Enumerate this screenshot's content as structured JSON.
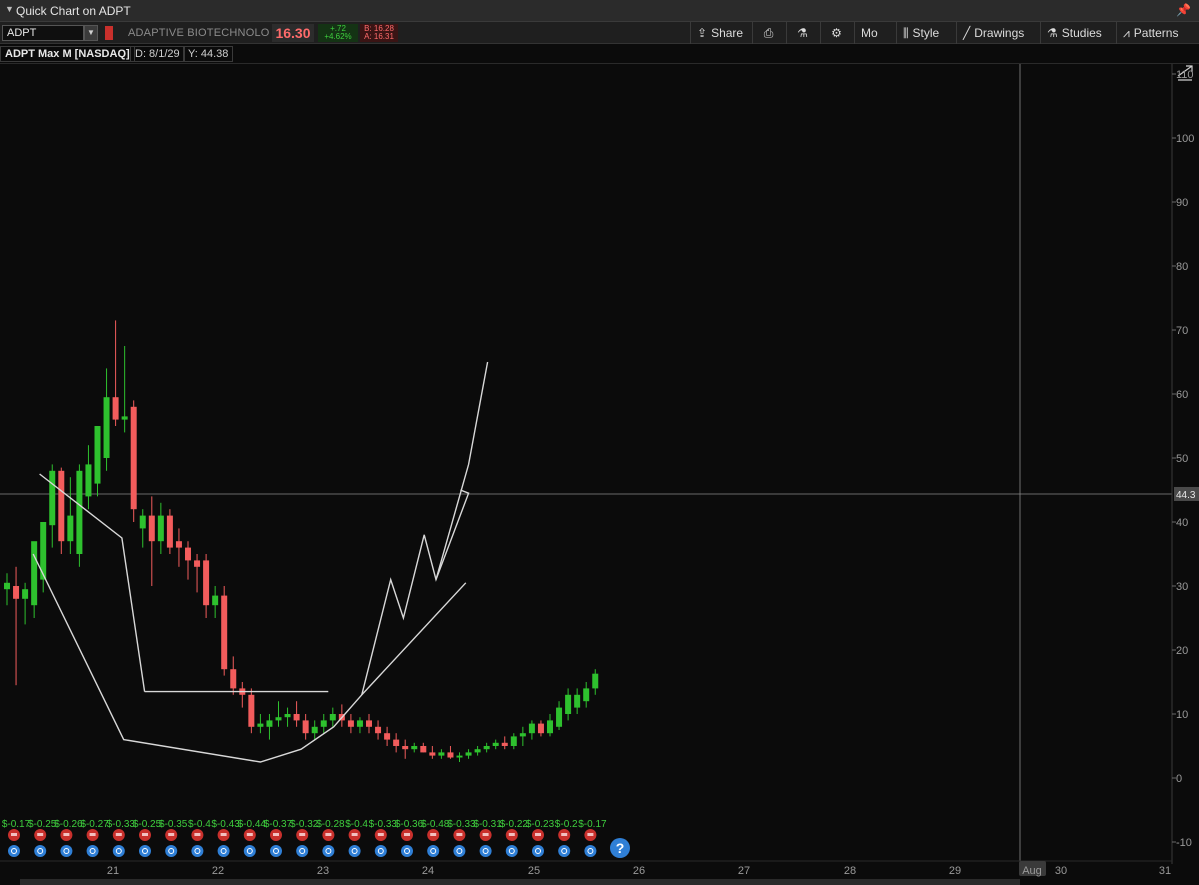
{
  "window": {
    "title": "Quick Chart on ADPT"
  },
  "toolbar": {
    "symbol": "ADPT",
    "company": "ADAPTIVE BIOTECHNOLO",
    "last_price": "16.30",
    "change": "+.72",
    "change_pct": "+4.62%",
    "bid": "B: 16.28",
    "ask": "A: 16.31",
    "buttons": {
      "share": "Share",
      "mo": "Mo",
      "style": "Style",
      "drawings": "Drawings",
      "studies": "Studies",
      "patterns": "Patterns"
    }
  },
  "infobar": {
    "chart_title": "ADPT Max M [NASDAQ]",
    "date_readout": "D: 8/1/29",
    "y_readout": "Y: 44.38"
  },
  "price_axis": {
    "ticks": [
      110,
      100,
      90,
      80,
      70,
      60,
      50,
      40,
      30,
      20,
      10,
      0,
      -10
    ],
    "crosshair_label": "44.3"
  },
  "time_axis": {
    "labels": [
      "21",
      "22",
      "23",
      "24",
      "25",
      "26",
      "27",
      "28",
      "29",
      "Aug",
      "30",
      "31"
    ]
  },
  "earnings": [
    "$-0.17",
    "$-0.25",
    "$-0.26",
    "$-0.27",
    "$-0.33",
    "$-0.25",
    "$-0.35",
    "$-0.4",
    "$-0.43",
    "$-0.44",
    "$-0.37",
    "$-0.32",
    "$-0.28",
    "$-0.4",
    "$-0.33",
    "$-0.36",
    "$-0.48",
    "$-0.33",
    "$-0.31",
    "$-0.22",
    "$-0.23",
    "$-0.2",
    "$-0.17"
  ],
  "colors": {
    "up": "#2ec12e",
    "down": "#f25c5c",
    "background": "#0b0b0b",
    "drawing": "#d8d8d8",
    "earnings_text": "#3ecf3e"
  },
  "chart_data": {
    "type": "candlestick",
    "title": "ADPT Max M [NASDAQ]",
    "ylim": [
      -12,
      113
    ],
    "note_markers": "?",
    "candles": [
      {
        "o": 29.5,
        "h": 32,
        "l": 27,
        "c": 30.5
      },
      {
        "o": 30,
        "h": 33,
        "l": 14.5,
        "c": 28
      },
      {
        "o": 28,
        "h": 30.5,
        "l": 24,
        "c": 29.5
      },
      {
        "o": 27,
        "h": 36.5,
        "l": 25,
        "c": 37
      },
      {
        "o": 31,
        "h": 39,
        "l": 29,
        "c": 40
      },
      {
        "o": 39.5,
        "h": 49,
        "l": 36,
        "c": 48
      },
      {
        "o": 48,
        "h": 48.5,
        "l": 35,
        "c": 37
      },
      {
        "o": 37,
        "h": 47,
        "l": 35,
        "c": 41
      },
      {
        "o": 35,
        "h": 49,
        "l": 33,
        "c": 48
      },
      {
        "o": 44,
        "h": 52,
        "l": 42,
        "c": 49
      },
      {
        "o": 46,
        "h": 53,
        "l": 44,
        "c": 55
      },
      {
        "o": 50,
        "h": 64,
        "l": 48,
        "c": 59.5
      },
      {
        "o": 59.5,
        "h": 71.5,
        "l": 55,
        "c": 56
      },
      {
        "o": 56,
        "h": 67.5,
        "l": 54,
        "c": 56.5
      },
      {
        "o": 58,
        "h": 59,
        "l": 40,
        "c": 42
      },
      {
        "o": 39,
        "h": 42,
        "l": 36,
        "c": 41
      },
      {
        "o": 41,
        "h": 44,
        "l": 30,
        "c": 37
      },
      {
        "o": 37,
        "h": 43,
        "l": 35,
        "c": 41
      },
      {
        "o": 41,
        "h": 42,
        "l": 35,
        "c": 36
      },
      {
        "o": 37,
        "h": 39,
        "l": 33,
        "c": 36
      },
      {
        "o": 36,
        "h": 37,
        "l": 31,
        "c": 34
      },
      {
        "o": 34,
        "h": 35,
        "l": 29,
        "c": 33
      },
      {
        "o": 34,
        "h": 35,
        "l": 25,
        "c": 27
      },
      {
        "o": 27,
        "h": 30,
        "l": 25,
        "c": 28.5
      },
      {
        "o": 28.5,
        "h": 30,
        "l": 16,
        "c": 17
      },
      {
        "o": 17,
        "h": 19,
        "l": 13,
        "c": 14
      },
      {
        "o": 14,
        "h": 15,
        "l": 11,
        "c": 13
      },
      {
        "o": 13,
        "h": 14,
        "l": 7,
        "c": 8
      },
      {
        "o": 8,
        "h": 10,
        "l": 7,
        "c": 8.5
      },
      {
        "o": 8,
        "h": 10,
        "l": 6,
        "c": 9
      },
      {
        "o": 9,
        "h": 12,
        "l": 8,
        "c": 9.5
      },
      {
        "o": 9.5,
        "h": 11,
        "l": 8,
        "c": 10
      },
      {
        "o": 10,
        "h": 12,
        "l": 8,
        "c": 9
      },
      {
        "o": 9,
        "h": 10,
        "l": 6,
        "c": 7
      },
      {
        "o": 7,
        "h": 9,
        "l": 6,
        "c": 8
      },
      {
        "o": 8,
        "h": 10,
        "l": 7,
        "c": 9
      },
      {
        "o": 9,
        "h": 11,
        "l": 8,
        "c": 10
      },
      {
        "o": 10,
        "h": 11.5,
        "l": 8,
        "c": 9
      },
      {
        "o": 9,
        "h": 10,
        "l": 7,
        "c": 8
      },
      {
        "o": 8,
        "h": 9.5,
        "l": 7,
        "c": 9
      },
      {
        "o": 9,
        "h": 10,
        "l": 7,
        "c": 8
      },
      {
        "o": 8,
        "h": 9,
        "l": 6,
        "c": 7
      },
      {
        "o": 7,
        "h": 8,
        "l": 5,
        "c": 6
      },
      {
        "o": 6,
        "h": 7,
        "l": 4,
        "c": 5
      },
      {
        "o": 5,
        "h": 6,
        "l": 3,
        "c": 4.5
      },
      {
        "o": 4.5,
        "h": 5.5,
        "l": 4,
        "c": 5
      },
      {
        "o": 5,
        "h": 5.5,
        "l": 4,
        "c": 4
      },
      {
        "o": 4,
        "h": 5,
        "l": 3,
        "c": 3.5
      },
      {
        "o": 3.5,
        "h": 4.5,
        "l": 3,
        "c": 4
      },
      {
        "o": 4,
        "h": 5,
        "l": 3,
        "c": 3.2
      },
      {
        "o": 3.2,
        "h": 4,
        "l": 2.5,
        "c": 3.5
      },
      {
        "o": 3.5,
        "h": 4.5,
        "l": 3,
        "c": 4
      },
      {
        "o": 4,
        "h": 5,
        "l": 3.5,
        "c": 4.5
      },
      {
        "o": 4.5,
        "h": 5.5,
        "l": 4,
        "c": 5
      },
      {
        "o": 5,
        "h": 6,
        "l": 4.5,
        "c": 5.5
      },
      {
        "o": 5.5,
        "h": 6.5,
        "l": 4.5,
        "c": 5
      },
      {
        "o": 5,
        "h": 7,
        "l": 4.5,
        "c": 6.5
      },
      {
        "o": 6.5,
        "h": 8,
        "l": 5,
        "c": 7
      },
      {
        "o": 7,
        "h": 9,
        "l": 6,
        "c": 8.5
      },
      {
        "o": 8.5,
        "h": 9,
        "l": 6.5,
        "c": 7
      },
      {
        "o": 7,
        "h": 10,
        "l": 6.5,
        "c": 9
      },
      {
        "o": 8,
        "h": 12,
        "l": 7.5,
        "c": 11
      },
      {
        "o": 10,
        "h": 14,
        "l": 9,
        "c": 13
      },
      {
        "o": 11,
        "h": 14,
        "l": 10,
        "c": 13
      },
      {
        "o": 12,
        "h": 15,
        "l": 11,
        "c": 14
      },
      {
        "o": 14,
        "h": 17,
        "l": 13,
        "c": 16.3
      }
    ],
    "annotations": {
      "cup_outline": [
        [
          2.9,
          35
        ],
        [
          12.9,
          6
        ],
        [
          28.0,
          2.5
        ],
        [
          32.5,
          4.5
        ],
        [
          36.1,
          8
        ],
        [
          39.2,
          13
        ],
        [
          50.7,
          30.5
        ]
      ],
      "cup_upper": [
        [
          3.6,
          47.5
        ],
        [
          12.7,
          37.5
        ],
        [
          15.2,
          13.5
        ]
      ],
      "handle_line": [
        [
          15.2,
          13.5
        ],
        [
          35.5,
          13.5
        ]
      ],
      "zigzag": [
        [
          39.2,
          13
        ],
        [
          42.4,
          31
        ],
        [
          43.8,
          25
        ],
        [
          46.1,
          38
        ],
        [
          47.4,
          31
        ],
        [
          51.0,
          44.5
        ],
        [
          50.1,
          45
        ]
      ],
      "projection": [
        [
          47.4,
          31
        ],
        [
          51.0,
          49
        ],
        [
          53.1,
          65
        ]
      ]
    },
    "crosshair": {
      "y": 44.38
    }
  }
}
